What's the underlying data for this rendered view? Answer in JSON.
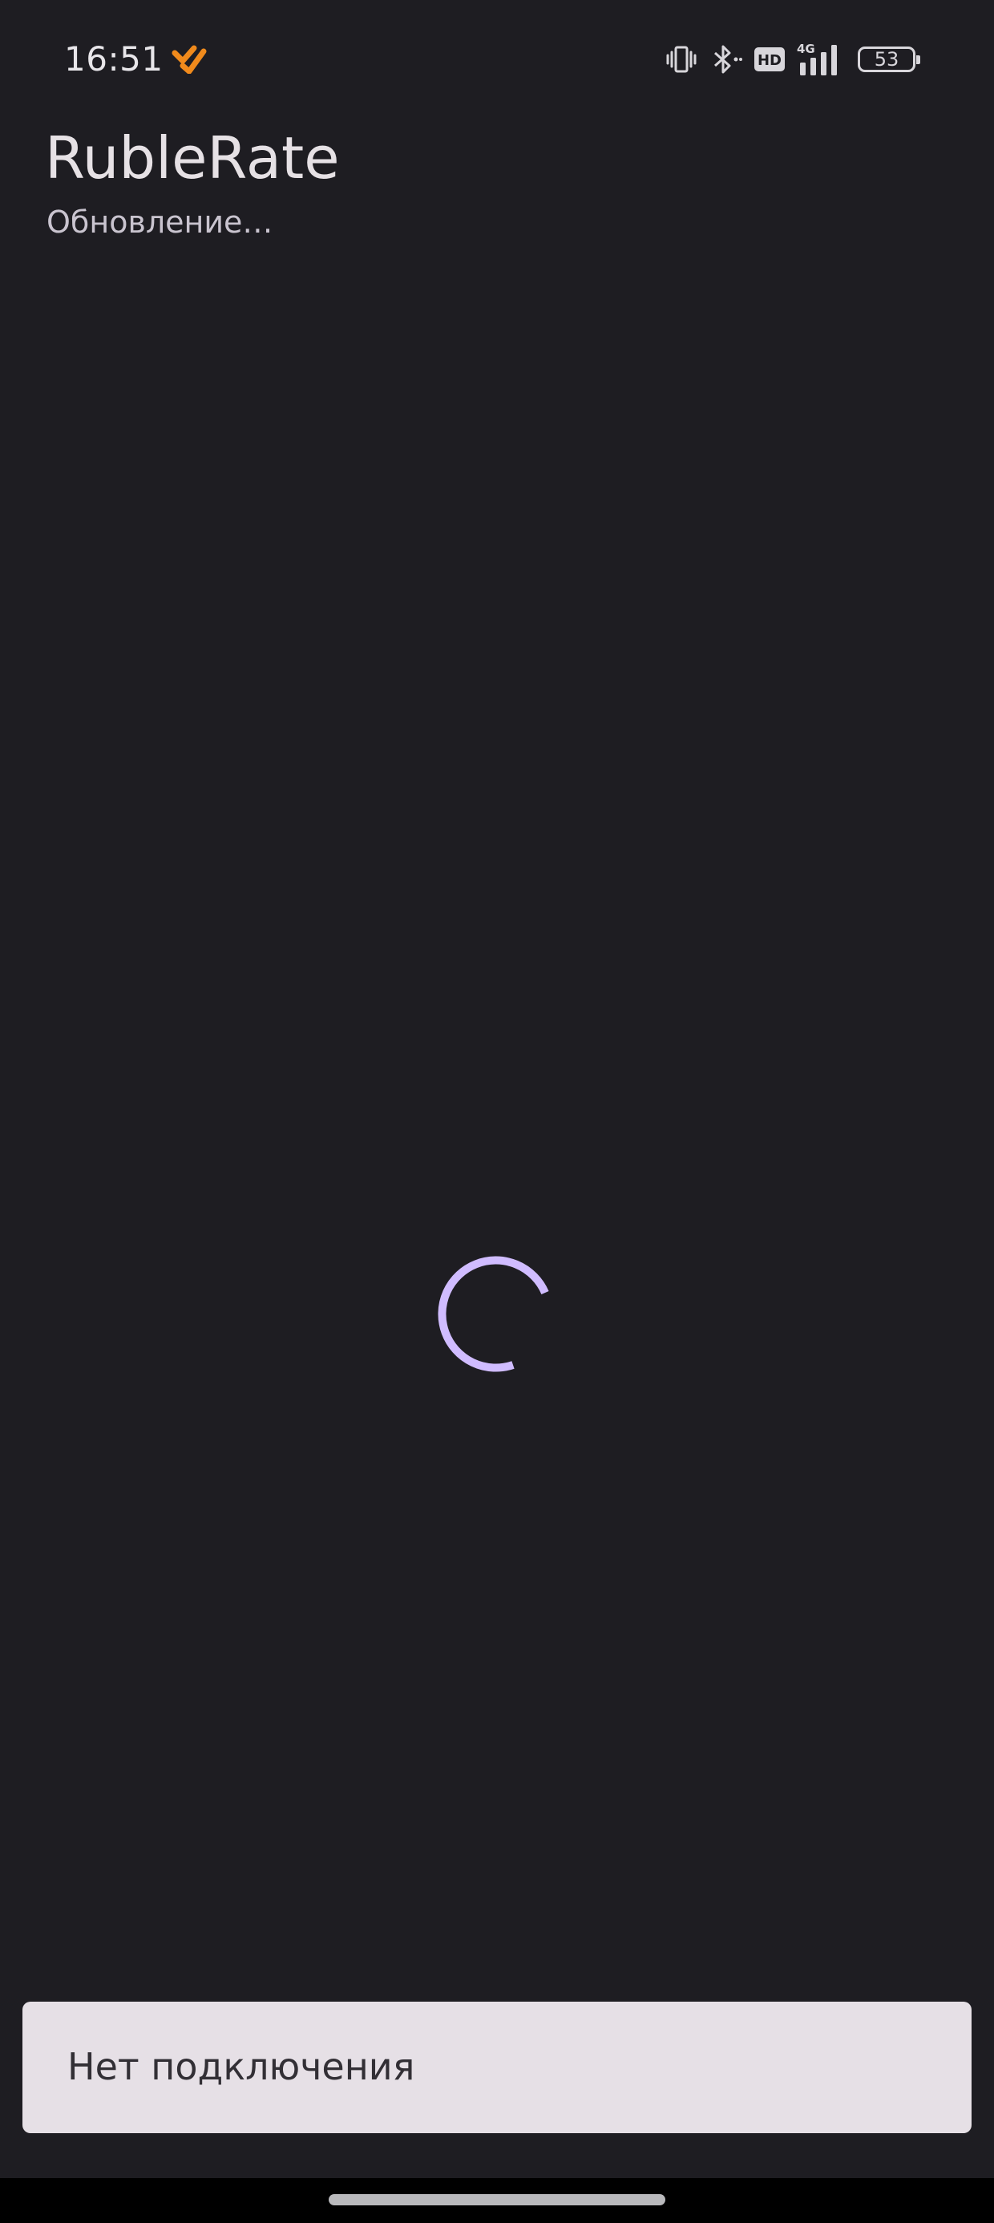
{
  "status_bar": {
    "time": "16:51",
    "notification_icon": "orange-app-logo-icon",
    "icons": [
      "vibrate-icon",
      "bluetooth-icon",
      "hd-voice-icon",
      "signal-4g-icon"
    ],
    "network_label": "4G",
    "hd_label": "HD",
    "battery_level": "53"
  },
  "app_bar": {
    "title": "RubleRate",
    "subtitle": "Обновление…"
  },
  "loading": {
    "indicator": "circular-progress",
    "color": "#d0bcff"
  },
  "snackbar": {
    "message": "Нет подключения"
  },
  "colors": {
    "background": "#1e1d22",
    "snackbar_background": "#e6e0e6",
    "accent": "#d0bcff",
    "notification_orange": "#f08a1c"
  }
}
